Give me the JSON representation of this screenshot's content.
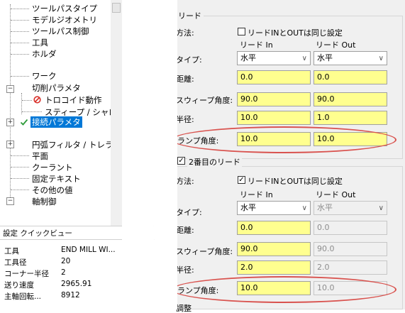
{
  "tree": {
    "items": [
      {
        "label": "ツールパスタイプ"
      },
      {
        "label": "モデルジオメトリ"
      },
      {
        "label": "ツールパス制御"
      },
      {
        "label": "工具"
      },
      {
        "label": "ホルダ"
      },
      {
        "label": "ワーク"
      },
      {
        "label": "切削パラメタ"
      },
      {
        "label": "トロコイド動作"
      },
      {
        "label": "スティープ / シャロー"
      },
      {
        "label": "接続パラメタ"
      },
      {
        "label": "円弧フィルタ / トレラン"
      },
      {
        "label": "平面"
      },
      {
        "label": "クーラント"
      },
      {
        "label": "固定テキスト"
      },
      {
        "label": "その他の値"
      },
      {
        "label": "軸制御"
      }
    ]
  },
  "quickview": {
    "title": "設定 クイックビュー",
    "rows": [
      {
        "label": "工具",
        "value": "END MILL WI..."
      },
      {
        "label": "工具径",
        "value": "20"
      },
      {
        "label": "コーナー半径",
        "value": "2"
      },
      {
        "label": "送り速度",
        "value": "2965.91"
      },
      {
        "label": "主軸回転...",
        "value": "8912"
      }
    ]
  },
  "lead": {
    "group_title": "リード",
    "method_label": "方法:",
    "same_label": "リードINとOUTは同じ設定",
    "col_in": "リード In",
    "col_out": "リード  Out",
    "type_label": "タイプ:",
    "type_in": "水平",
    "type_out": "水平",
    "distance_label": "距離:",
    "distance_in": "0.0",
    "distance_out": "0.0",
    "sweep_label": "スウィープ角度:",
    "sweep_in": "90.0",
    "sweep_out": "90.0",
    "radius_label": "半径:",
    "radius_in": "10.0",
    "radius_out": "1.0",
    "ramp_label": "ランプ角度:",
    "ramp_in": "10.0",
    "ramp_out": "10.0"
  },
  "lead2": {
    "group_title": "2番目のリード",
    "method_label": "方法:",
    "same_label": "リードINとOUTは同じ設定",
    "col_in": "リード In",
    "col_out": "リード  Out",
    "type_label": "タイプ:",
    "type_in": "水平",
    "type_out": "水平",
    "distance_label": "距離:",
    "distance_in": "0.0",
    "distance_out": "0.0",
    "sweep_label": "スウィープ角度:",
    "sweep_in": "90.0",
    "sweep_out": "90.0",
    "radius_label": "半径:",
    "radius_in": "2.0",
    "radius_out": "2.0",
    "ramp_label": "ランプ角度:",
    "ramp_in": "10.0",
    "ramp_out": "10.0",
    "bottom_label": "調整"
  },
  "colors": {
    "field_yellow": "#ffff8f",
    "highlight_red": "#d9534f",
    "selected_blue": "#0078d7",
    "forbidden_red": "#d9302a",
    "check_green": "#2e9b3a"
  },
  "icons": {
    "forbidden": "forbidden-icon",
    "check": "check-icon",
    "expand": "expand-icon",
    "collapse": "collapse-icon"
  }
}
